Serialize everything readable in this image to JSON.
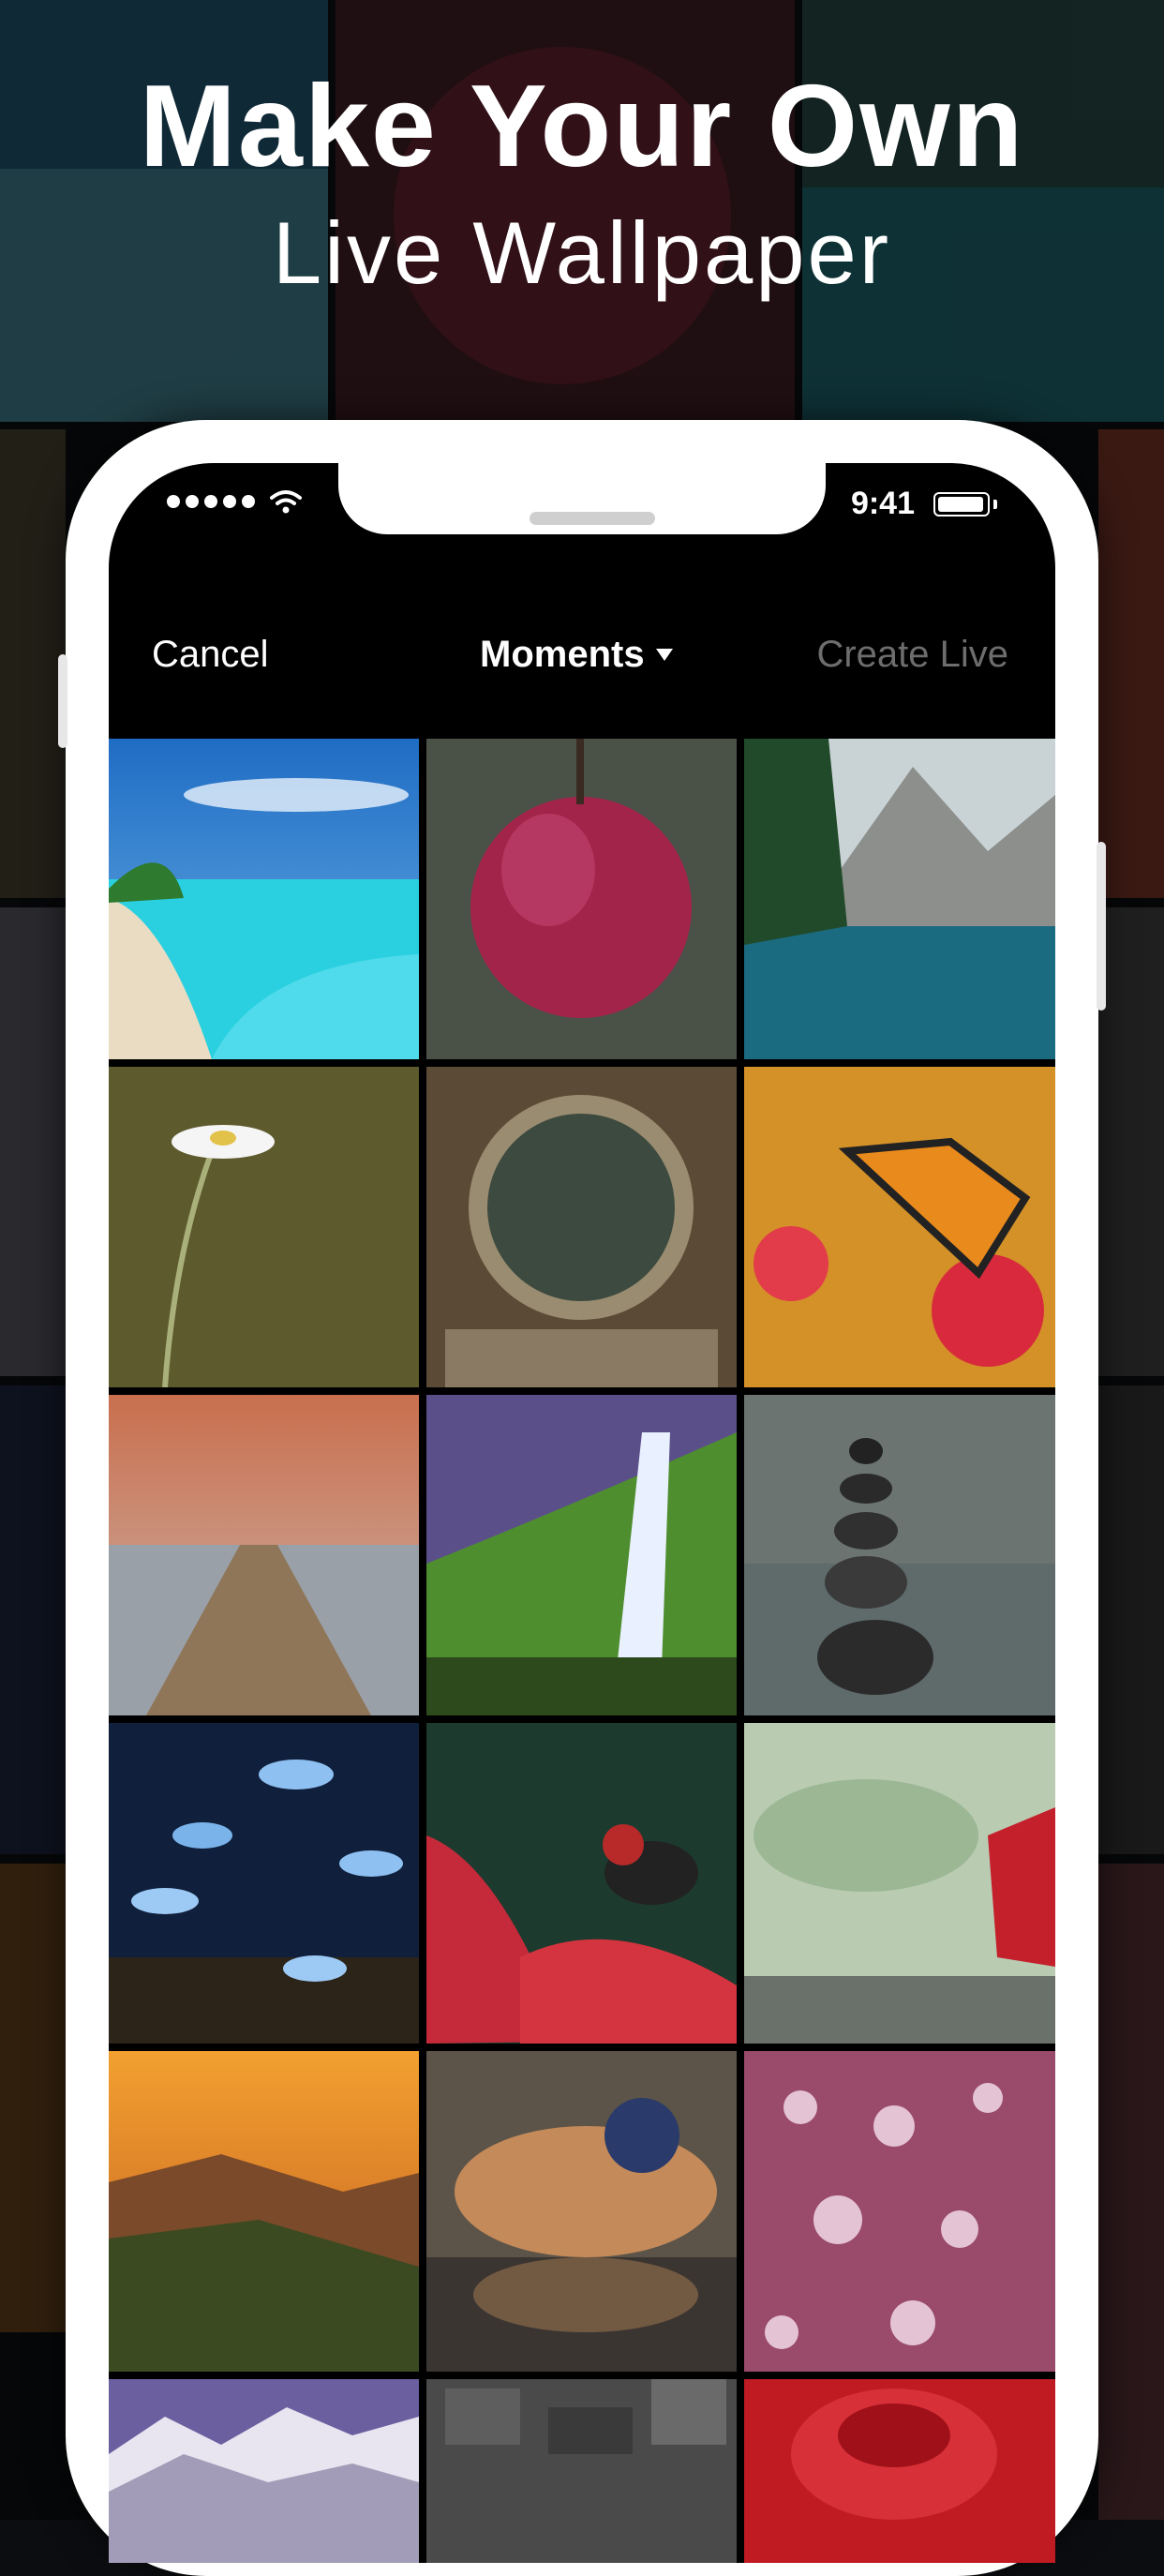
{
  "headline": {
    "line1": "Make Your Own",
    "line2": "Live Wallpaper"
  },
  "status_bar": {
    "signal_icon": "signal-dots-icon",
    "wifi_icon": "wifi-icon",
    "time": "9:41",
    "battery_icon": "battery-icon"
  },
  "nav": {
    "cancel_label": "Cancel",
    "title": "Moments",
    "dropdown_icon": "caret-down-icon",
    "create_label": "Create Live",
    "create_color": "#6d6d6d"
  },
  "grid": {
    "photos": [
      {
        "subject": "tropical-beach"
      },
      {
        "subject": "red-apple"
      },
      {
        "subject": "mountain-lake"
      },
      {
        "subject": "white-daisy"
      },
      {
        "subject": "crystal-ball"
      },
      {
        "subject": "butterfly-flowers"
      },
      {
        "subject": "wooden-pier-sunset"
      },
      {
        "subject": "waterfall"
      },
      {
        "subject": "stacked-stones"
      },
      {
        "subject": "blue-butterflies"
      },
      {
        "subject": "red-bird"
      },
      {
        "subject": "misty-forest"
      },
      {
        "subject": "mountain-sunset"
      },
      {
        "subject": "mandarin-duck"
      },
      {
        "subject": "leaf-water-drops"
      },
      {
        "subject": "snowy-mountains"
      },
      {
        "subject": "grey-texture"
      },
      {
        "subject": "red-rose"
      }
    ]
  }
}
